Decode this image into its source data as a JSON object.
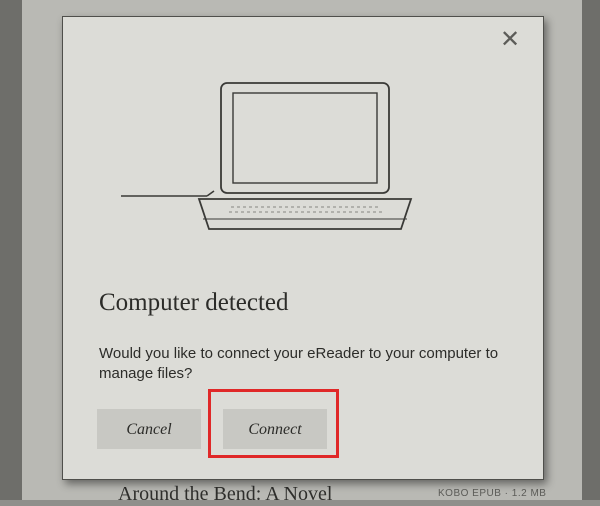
{
  "background": {
    "book_title": "Around the Bend: A Novel",
    "book_meta": "KOBO EPUB · 1.2 MB"
  },
  "dialog": {
    "close_glyph": "✕",
    "title": "Computer detected",
    "message": "Would you like to connect your eReader to your computer to manage files?",
    "cancel_label": "Cancel",
    "connect_label": "Connect"
  },
  "colors": {
    "highlight": "#e02828",
    "dialog_bg": "#dcdcd7",
    "button_bg": "#c8c8c3"
  },
  "icons": {
    "illustration": "laptop-icon",
    "close": "close-icon"
  }
}
